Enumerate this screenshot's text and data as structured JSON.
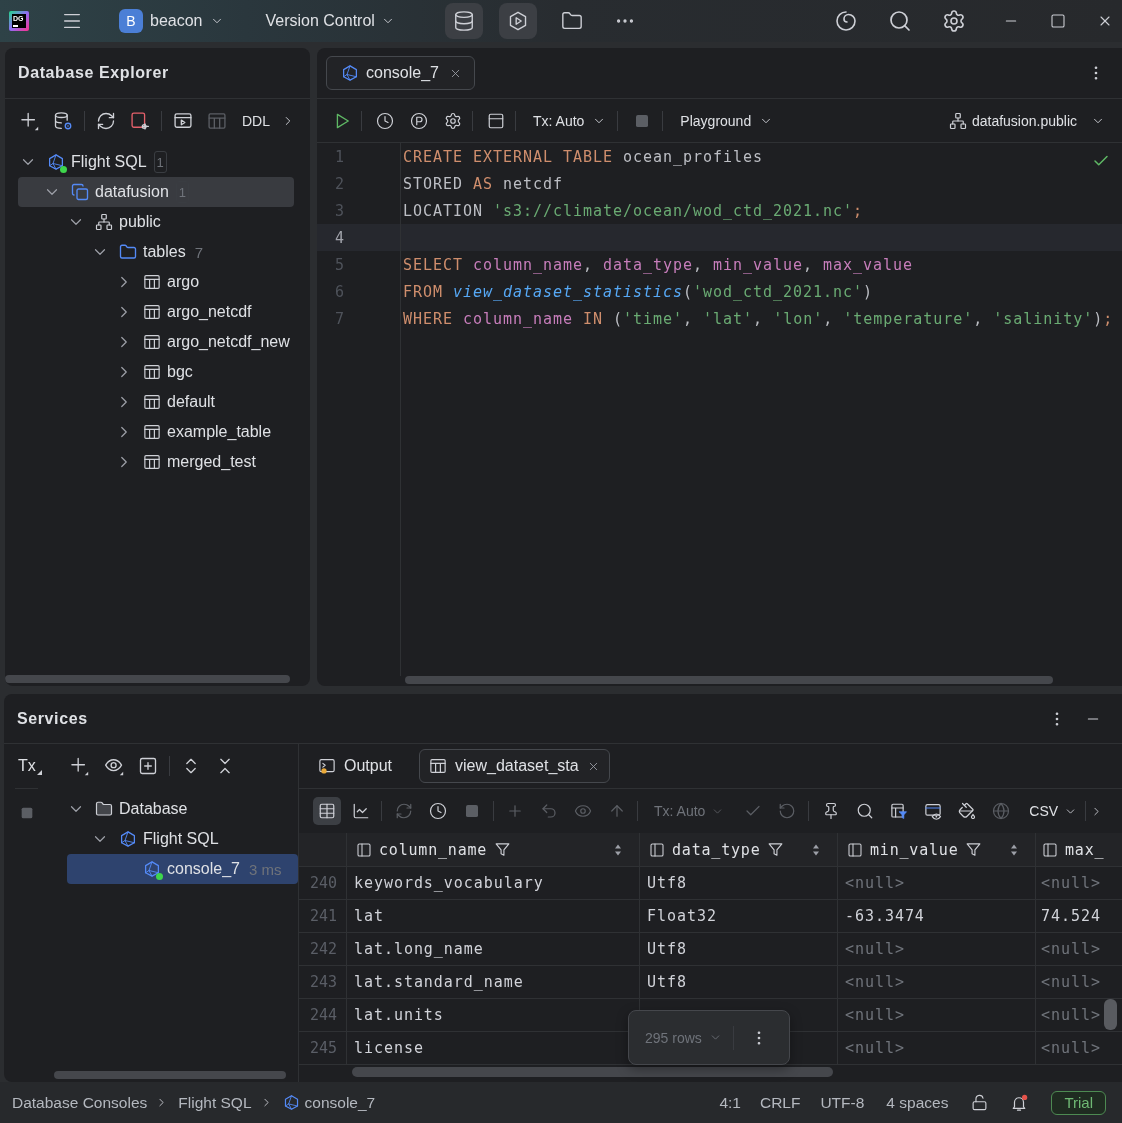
{
  "title_bar": {
    "app_logo": "DG",
    "project_initial": "B",
    "project": "beacon",
    "vcs": "Version Control",
    "tool_windows": [
      {
        "selected": true
      },
      {
        "selected": true
      },
      {
        "selected": false
      }
    ]
  },
  "database_explorer": {
    "title": "Database Explorer",
    "toolbar_label": "DDL",
    "tree": [
      {
        "label": "Flight SQL",
        "kind": "connection",
        "badge": "1",
        "expanded": true,
        "selected": false,
        "connected": true,
        "children": [
          {
            "label": "datafusion",
            "kind": "database",
            "badge": "1",
            "expanded": true,
            "selected": true,
            "connected": false,
            "children": [
              {
                "label": "public",
                "kind": "schema",
                "expanded": true,
                "selected": false,
                "connected": false,
                "children": [
                  {
                    "label": "tables",
                    "kind": "folder",
                    "count": "7",
                    "expanded": true,
                    "selected": false,
                    "connected": false,
                    "children": [
                      {
                        "label": "argo",
                        "kind": "table",
                        "expanded": false,
                        "selected": false,
                        "connected": false
                      },
                      {
                        "label": "argo_netcdf",
                        "kind": "table",
                        "expanded": false,
                        "selected": false,
                        "connected": false
                      },
                      {
                        "label": "argo_netcdf_new",
                        "kind": "table",
                        "expanded": false,
                        "selected": false,
                        "connected": false
                      },
                      {
                        "label": "bgc",
                        "kind": "table",
                        "expanded": false,
                        "selected": false,
                        "connected": false
                      },
                      {
                        "label": "default",
                        "kind": "table",
                        "expanded": false,
                        "selected": false,
                        "connected": false
                      },
                      {
                        "label": "example_table",
                        "kind": "table",
                        "expanded": false,
                        "selected": false,
                        "connected": false
                      },
                      {
                        "label": "merged_test",
                        "kind": "table",
                        "expanded": false,
                        "selected": false,
                        "connected": false
                      }
                    ]
                  }
                ]
              }
            ]
          }
        ]
      }
    ]
  },
  "editor": {
    "tabs": [
      {
        "label": "console_7",
        "selected": true
      }
    ],
    "toolbar": {
      "tx_mode": "Tx: Auto",
      "session": "Playground",
      "schema": "datafusion.public"
    },
    "inspection_ok": true,
    "lines": [
      {
        "number": "1",
        "current": false,
        "tokens": [
          {
            "text": "CREATE EXTERNAL TABLE ",
            "kind": "keyword"
          },
          {
            "text": "ocean_profiles",
            "kind": "plain"
          }
        ]
      },
      {
        "number": "2",
        "current": false,
        "tokens": [
          {
            "text": "STORED ",
            "kind": "plain"
          },
          {
            "text": "AS ",
            "kind": "keyword"
          },
          {
            "text": "netcdf",
            "kind": "plain"
          }
        ]
      },
      {
        "number": "3",
        "current": false,
        "tokens": [
          {
            "text": "LOCATION ",
            "kind": "plain"
          },
          {
            "text": "'s3://climate/ocean/wod_ctd_2021.nc'",
            "kind": "string"
          },
          {
            "text": ";",
            "kind": "keyword"
          }
        ]
      },
      {
        "number": "4",
        "current": true
      },
      {
        "number": "5",
        "current": false,
        "tokens": [
          {
            "text": "SELECT ",
            "kind": "keyword"
          },
          {
            "text": "column_name",
            "kind": "identifier"
          },
          {
            "text": ", ",
            "kind": "plain"
          },
          {
            "text": "data_type",
            "kind": "identifier"
          },
          {
            "text": ", ",
            "kind": "plain"
          },
          {
            "text": "min_value",
            "kind": "identifier"
          },
          {
            "text": ", ",
            "kind": "plain"
          },
          {
            "text": "max_value",
            "kind": "identifier"
          }
        ]
      },
      {
        "number": "6",
        "current": false,
        "tokens": [
          {
            "text": "FROM ",
            "kind": "keyword"
          },
          {
            "text": "view_dataset_statistics",
            "kind": "function"
          },
          {
            "text": "(",
            "kind": "plain"
          },
          {
            "text": "'wod_ctd_2021.nc'",
            "kind": "string"
          },
          {
            "text": ")",
            "kind": "plain"
          }
        ]
      },
      {
        "number": "7",
        "current": false,
        "tokens": [
          {
            "text": "WHERE ",
            "kind": "keyword"
          },
          {
            "text": "column_name",
            "kind": "identifier"
          },
          {
            "text": " IN ",
            "kind": "keyword"
          },
          {
            "text": "(",
            "kind": "plain"
          },
          {
            "text": "'time'",
            "kind": "string"
          },
          {
            "text": ", ",
            "kind": "plain"
          },
          {
            "text": "'lat'",
            "kind": "string"
          },
          {
            "text": ", ",
            "kind": "plain"
          },
          {
            "text": "'lon'",
            "kind": "string"
          },
          {
            "text": ", ",
            "kind": "plain"
          },
          {
            "text": "'temperature'",
            "kind": "string"
          },
          {
            "text": ", ",
            "kind": "plain"
          },
          {
            "text": "'salinity'",
            "kind": "string"
          },
          {
            "text": ")",
            "kind": "plain"
          },
          {
            "text": ";",
            "kind": "keyword"
          }
        ]
      }
    ]
  },
  "services": {
    "title": "Services",
    "tx_label": "Tx",
    "tree": [
      {
        "label": "Database",
        "kind": "group",
        "expanded": true,
        "selected": false,
        "connected": false,
        "children": [
          {
            "label": "Flight SQL",
            "kind": "connection",
            "expanded": true,
            "selected": false,
            "connected": false,
            "children": [
              {
                "label": "console_7",
                "kind": "console",
                "time": "3 ms",
                "selected": true,
                "connected": true
              }
            ]
          }
        ]
      }
    ],
    "result_tabs": [
      {
        "label": "Output",
        "kind": "output",
        "selected": false
      },
      {
        "label": "view_dataset_sta",
        "kind": "table",
        "selected": true
      }
    ],
    "result_toolbar": {
      "buttons": [
        {
          "selected": true,
          "disabled": false
        },
        {
          "selected": false,
          "disabled": false
        },
        {
          "selected": false,
          "disabled": true
        },
        {
          "selected": false,
          "disabled": false
        },
        {
          "selected": false,
          "disabled": true
        },
        {
          "selected": false,
          "disabled": true
        },
        {
          "selected": false,
          "disabled": true
        },
        {
          "selected": false,
          "disabled": true
        },
        {
          "selected": false,
          "disabled": true
        },
        {
          "selected": false,
          "disabled": true
        },
        {
          "selected": false,
          "disabled": true
        },
        {
          "selected": false,
          "disabled": false
        },
        {
          "selected": false,
          "disabled": false
        },
        {
          "selected": false,
          "disabled": false
        },
        {
          "selected": false,
          "disabled": false
        },
        {
          "selected": false,
          "disabled": false
        },
        {
          "selected": false,
          "disabled": true
        }
      ],
      "tx_mode": {
        "label": "Tx: Auto",
        "disabled": true
      },
      "format": "CSV"
    },
    "table": {
      "columns": [
        {
          "name": "column_name",
          "filter": true
        },
        {
          "name": "data_type",
          "filter": true
        },
        {
          "name": "min_value",
          "filter": true
        },
        {
          "name": "max_",
          "filter": false
        }
      ],
      "rows": [
        {
          "number": "240",
          "cells": [
            {
              "text": "keywords_vocabulary",
              "null": false
            },
            {
              "text": "Utf8",
              "null": false
            },
            {
              "text": "<null>",
              "null": true
            },
            {
              "text": "<null>",
              "null": true
            }
          ]
        },
        {
          "number": "241",
          "cells": [
            {
              "text": "lat",
              "null": false
            },
            {
              "text": "Float32",
              "null": false
            },
            {
              "text": "-63.3474",
              "null": false
            },
            {
              "text": "74.524",
              "null": false
            }
          ]
        },
        {
          "number": "242",
          "cells": [
            {
              "text": "lat.long_name",
              "null": false
            },
            {
              "text": "Utf8",
              "null": false
            },
            {
              "text": "<null>",
              "null": true
            },
            {
              "text": "<null>",
              "null": true
            }
          ]
        },
        {
          "number": "243",
          "cells": [
            {
              "text": "lat.standard_name",
              "null": false
            },
            {
              "text": "Utf8",
              "null": false
            },
            {
              "text": "<null>",
              "null": true
            },
            {
              "text": "<null>",
              "null": true
            }
          ]
        },
        {
          "number": "244",
          "cells": [
            {
              "text": "lat.units",
              "null": false
            },
            {
              "covered": true
            },
            {
              "text": "<null>",
              "null": true
            },
            {
              "text": "<null>",
              "null": true
            }
          ]
        },
        {
          "number": "245",
          "cells": [
            {
              "text": "license",
              "null": false
            },
            {
              "covered": true
            },
            {
              "text": "<null>",
              "null": true
            },
            {
              "text": "<null>",
              "null": true
            }
          ]
        }
      ]
    },
    "row_count": "295 rows"
  },
  "status_bar": {
    "breadcrumbs": [
      {
        "label": "Database Consoles",
        "kind": "text"
      },
      {
        "label": "Flight SQL",
        "kind": "text"
      },
      {
        "label": "console_7",
        "kind": "console"
      }
    ],
    "position": "4:1",
    "line_separator": "CRLF",
    "encoding": "UTF-8",
    "indent": "4 spaces",
    "unread_notifications": true,
    "license": "Trial"
  }
}
